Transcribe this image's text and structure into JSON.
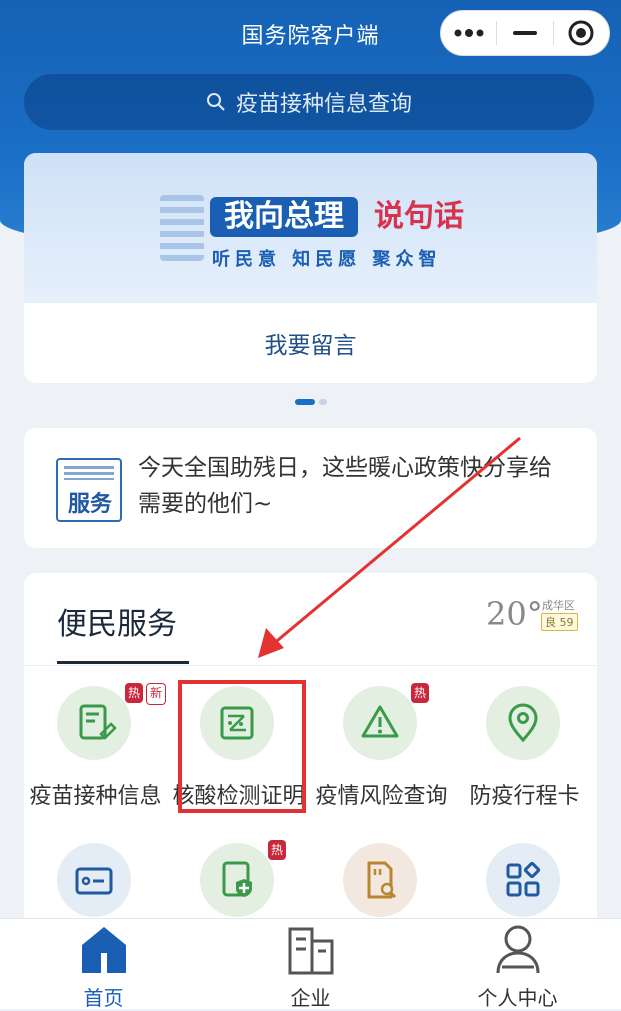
{
  "window": {
    "title": "国务院客户端"
  },
  "search": {
    "placeholder": "疫苗接种信息查询"
  },
  "banner": {
    "headline_blue": "我向总理",
    "headline_red": "说句话",
    "subtitle": "听民意 知民愿 聚众智",
    "button_label": "我要留言"
  },
  "carousel": {
    "pages": 2,
    "active_index": 0
  },
  "notice": {
    "badge": "服务",
    "text": "今天全国助残日，这些暖心政策快分享给需要的他们~"
  },
  "services": {
    "title": "便民服务",
    "weather": {
      "temperature": "20°",
      "district": "成华区",
      "aqi": "良 59"
    },
    "items": [
      {
        "label": "疫苗接种信息",
        "icon": "vaccine-doc-icon",
        "badges": [
          "热",
          "新"
        ]
      },
      {
        "label": "核酸检测证明",
        "icon": "test-certificate-icon",
        "badges": []
      },
      {
        "label": "疫情风险查询",
        "icon": "warning-icon",
        "badges": [
          "热"
        ]
      },
      {
        "label": "防疫行程卡",
        "icon": "location-pin-icon",
        "badges": []
      },
      {
        "label": "",
        "icon": "id-card-icon",
        "badges": []
      },
      {
        "label": "",
        "icon": "health-shield-icon",
        "badges": [
          "热"
        ]
      },
      {
        "label": "",
        "icon": "sim-card-search-icon",
        "badges": []
      },
      {
        "label": "",
        "icon": "apps-grid-icon",
        "badges": []
      }
    ]
  },
  "tabbar": {
    "items": [
      {
        "label": "首页",
        "icon": "home-icon",
        "active": true
      },
      {
        "label": "企业",
        "icon": "building-icon",
        "active": false
      },
      {
        "label": "个人中心",
        "icon": "user-icon",
        "active": false
      }
    ]
  },
  "colors": {
    "primary": "#1a5fb4",
    "hot": "#c9273c",
    "highlight": "#e43131"
  }
}
